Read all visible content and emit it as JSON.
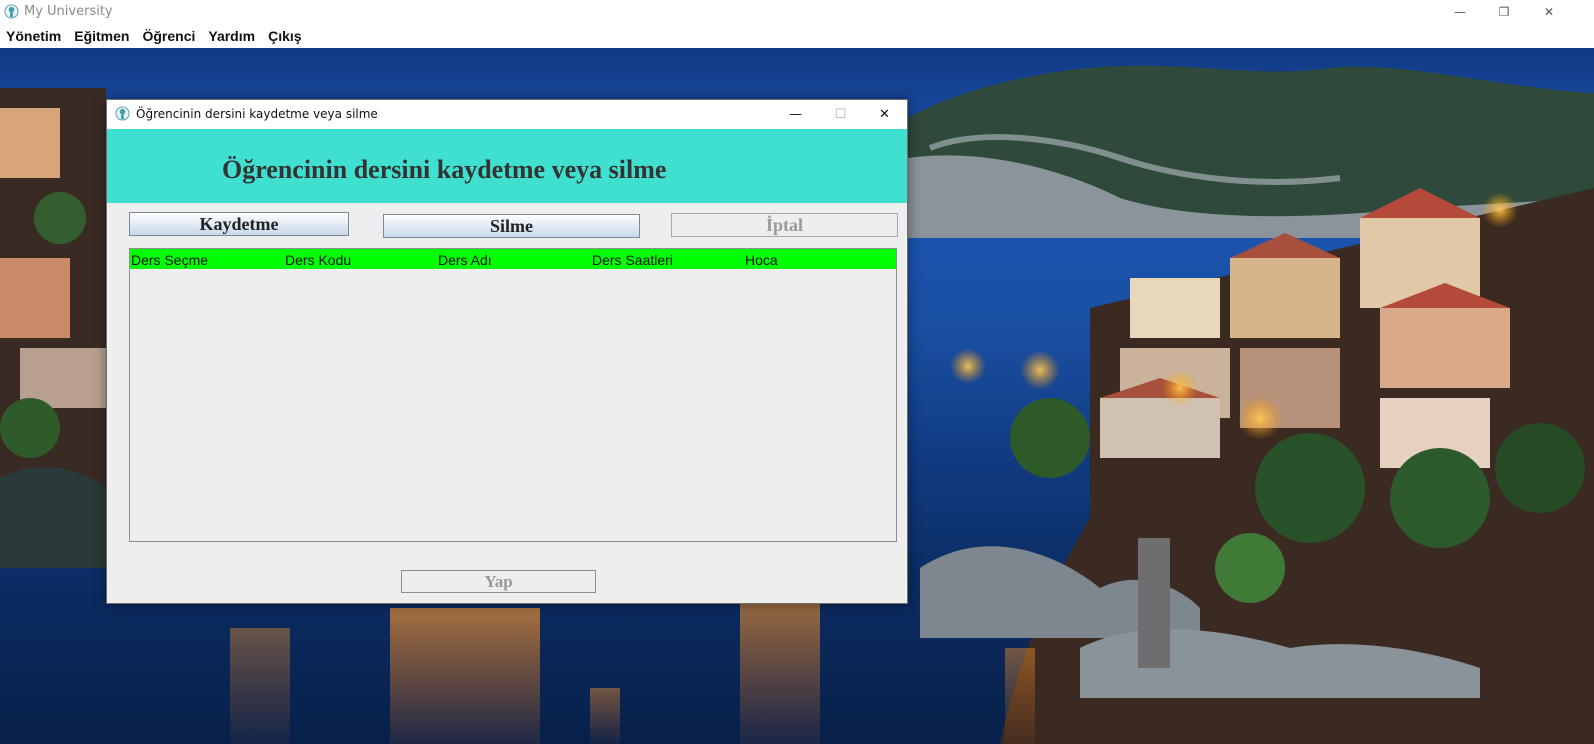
{
  "app": {
    "title": "My University",
    "window_controls": {
      "minimize": "—",
      "restore": "❐",
      "close": "✕"
    }
  },
  "menubar": {
    "items": [
      {
        "label": "Yönetim"
      },
      {
        "label": "Eğitmen"
      },
      {
        "label": "Öğrenci"
      },
      {
        "label": "Yardım"
      },
      {
        "label": "Çıkış"
      }
    ]
  },
  "dialog": {
    "title": "Öğrencinin dersini kaydetme veya silme",
    "heading": "Öğrencinin dersini kaydetme veya silme",
    "window_controls": {
      "minimize": "—",
      "maximize": "☐",
      "close": "✕"
    },
    "buttons": {
      "kaydetme": "Kaydetme",
      "silme": "Silme",
      "iptal": "İptal",
      "yap": "Yap"
    },
    "table": {
      "columns": [
        "Ders Seçme",
        "Ders Kodu",
        "Ders Adı",
        "Ders Saatleri",
        "Hoca"
      ],
      "rows": []
    }
  },
  "colors": {
    "banner": "#40e0d0",
    "table_header": "#00ff00",
    "dialog_bg": "#eeeeee"
  },
  "icons": [
    "app-icon",
    "dialog-icon"
  ]
}
